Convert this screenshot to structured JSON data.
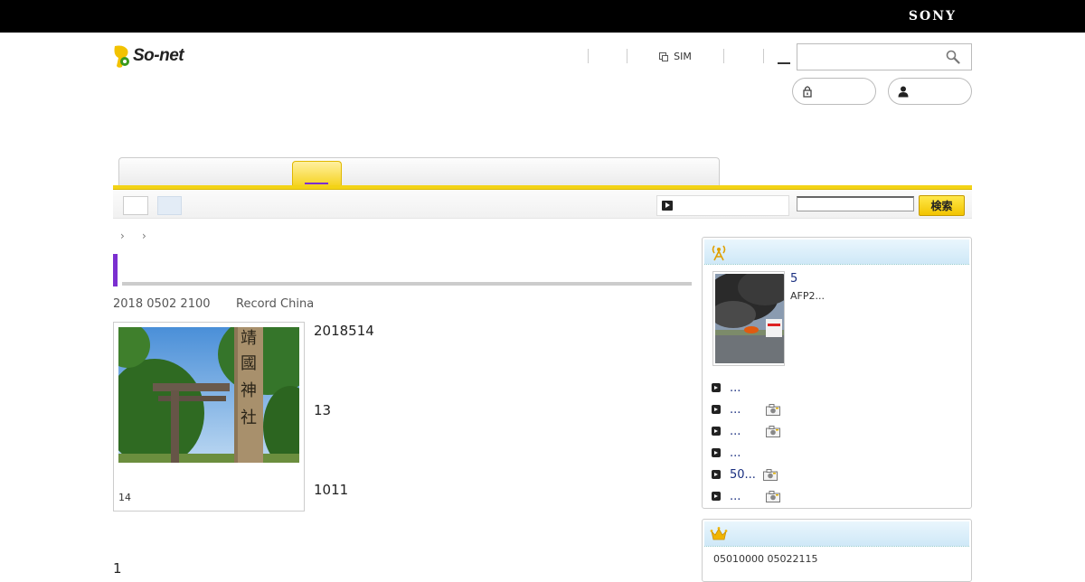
{
  "header": {
    "sony_logo": "SONY",
    "site_logo": "So-net",
    "nav": {
      "sim_label": "SIM"
    },
    "search": {
      "placeholder": "",
      "button_label": "検索"
    }
  },
  "breadcrumb": {
    "items": [
      "",
      ""
    ]
  },
  "article": {
    "title": "",
    "date": "2018 0502 2100",
    "source": "Record China",
    "photo_caption": "14",
    "paragraphs": [
      "2018514",
      "13",
      "1011"
    ],
    "bottom_text": "1"
  },
  "sidebar": {
    "feature": {
      "title": "5",
      "desc": "AFP2..."
    },
    "news": [
      {
        "text": "...",
        "photo": false
      },
      {
        "text": "...",
        "photo": true
      },
      {
        "text": "...",
        "photo": true
      },
      {
        "text": "...",
        "photo": false
      },
      {
        "text": "50...",
        "photo": true
      },
      {
        "text": "...",
        "photo": true
      }
    ],
    "ranking_text": "05010000  05022115"
  },
  "colors": {
    "accent_purple": "#7b2fd0",
    "tab_yellow": "#f3d316",
    "link_navy": "#1a2f80"
  }
}
